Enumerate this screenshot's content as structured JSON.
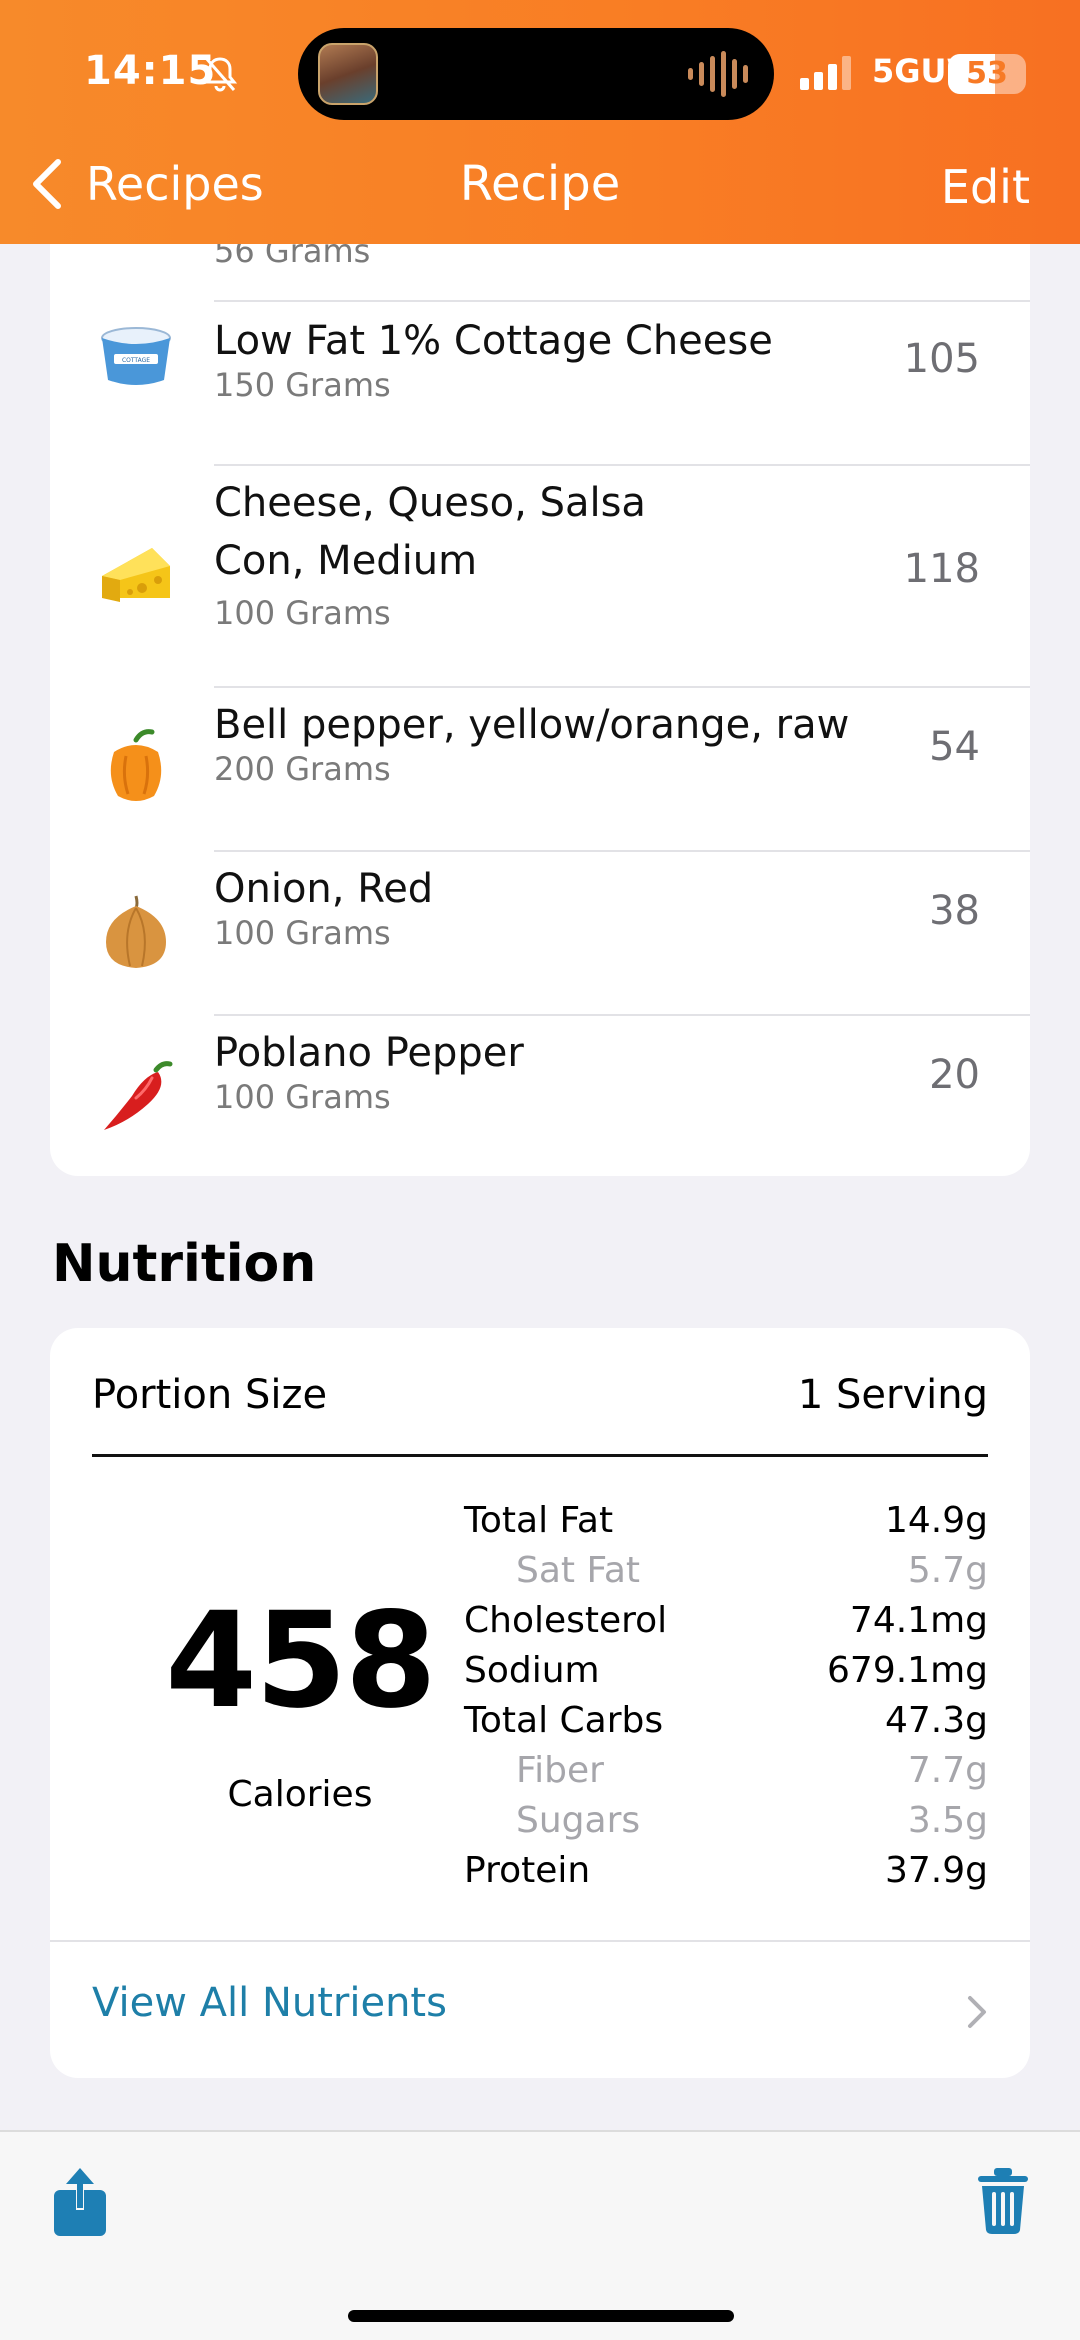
{
  "status_bar": {
    "time": "14:15",
    "network": "5GUW",
    "battery": "53",
    "icons": [
      "bell-slash-icon",
      "signal-icon",
      "battery-icon"
    ]
  },
  "nav": {
    "back_label": "Recipes",
    "title": "Recipe",
    "edit_label": "Edit"
  },
  "ingredients": {
    "partial_item_sub": "56 Grams",
    "items": [
      {
        "name": "Low Fat 1% Cottage Cheese",
        "amount": "150 Grams",
        "calories": "105",
        "icon": "cottage-cheese-icon"
      },
      {
        "name": "Cheese, Queso, Salsa Con, Medium",
        "name_line1": "Cheese, Queso, Salsa",
        "name_line2": "Con, Medium",
        "amount": "100 Grams",
        "calories": "118",
        "icon": "cheese-wedge-icon"
      },
      {
        "name": "Bell pepper, yellow/orange, raw",
        "amount": "200 Grams",
        "calories": "54",
        "icon": "bell-pepper-icon"
      },
      {
        "name": "Onion, Red",
        "amount": "100 Grams",
        "calories": "38",
        "icon": "onion-icon"
      },
      {
        "name": "Poblano Pepper",
        "amount": "100 Grams",
        "calories": "20",
        "icon": "chili-pepper-icon"
      }
    ]
  },
  "nutrition": {
    "heading": "Nutrition",
    "portion_label": "Portion Size",
    "portion_value": "1 Serving",
    "calories": "458",
    "calories_label": "Calories",
    "nutrients": [
      {
        "label": "Total Fat",
        "value": "14.9g",
        "sub": false
      },
      {
        "label": "Sat Fat",
        "value": "5.7g",
        "sub": true
      },
      {
        "label": "Cholesterol",
        "value": "74.1mg",
        "sub": false
      },
      {
        "label": "Sodium",
        "value": "679.1mg",
        "sub": false
      },
      {
        "label": "Total Carbs",
        "value": "47.3g",
        "sub": false
      },
      {
        "label": "Fiber",
        "value": "7.7g",
        "sub": true
      },
      {
        "label": "Sugars",
        "value": "3.5g",
        "sub": true
      },
      {
        "label": "Protein",
        "value": "37.9g",
        "sub": false
      }
    ],
    "view_all_label": "View All Nutrients"
  },
  "toolbar": {
    "share_icon": "share-icon",
    "trash_icon": "trash-icon"
  },
  "colors": {
    "header": "#f97d24",
    "link": "#1e7fa8",
    "toolbar_icon": "#1e7fb4"
  }
}
